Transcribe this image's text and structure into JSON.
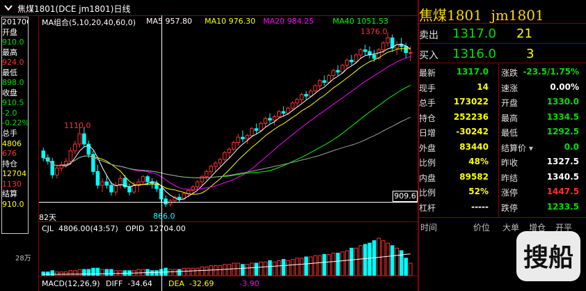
{
  "title": "焦煤1801(DCE jm1801)日线",
  "left_panel": [
    {
      "text": "20170601",
      "color": "#ffffff"
    },
    {
      "text": "开盘",
      "color": "#ffffff"
    },
    {
      "text": "910.0",
      "color": "#00e000"
    },
    {
      "text": "最高",
      "color": "#ffffff"
    },
    {
      "text": "924.0",
      "color": "#ff3030"
    },
    {
      "text": "最低",
      "color": "#ffffff"
    },
    {
      "text": "898.0",
      "color": "#00e000"
    },
    {
      "text": "收盘",
      "color": "#ffffff"
    },
    {
      "text": "910.5",
      "color": "#00e000"
    },
    {
      "text": "-2.0",
      "color": "#00e000"
    },
    {
      "text": "-0.22%",
      "color": "#00e000"
    },
    {
      "text": "总手",
      "color": "#ffffff"
    },
    {
      "text": "4806",
      "color": "#ffff00"
    },
    {
      "text": "676",
      "color": "#ff3030"
    },
    {
      "text": "持仓",
      "color": "#ffffff"
    },
    {
      "text": "12704",
      "color": "#ffff00"
    },
    {
      "text": "1130",
      "color": "#ff3030"
    },
    {
      "text": "结算",
      "color": "#ffffff"
    },
    {
      "text": "910.0",
      "color": "#ffff00"
    }
  ],
  "ma": {
    "label": "MA组合(5,10,20,40,60,0)",
    "items": [
      {
        "label": "MA5 957.80",
        "color": "#ffffff"
      },
      {
        "label": "MA10 976.30",
        "color": "#ffff00"
      },
      {
        "label": "MA20 984.25",
        "color": "#ff00ff"
      },
      {
        "label": "MA40 1051.53",
        "color": "#00ff00"
      }
    ]
  },
  "chart_labels": {
    "high": "1376.0",
    "mid_high": "1110.0",
    "low": "866.0",
    "price_tag": "909.6",
    "days": "82天"
  },
  "volume": {
    "header": "CJL  4806.00(43:57)   OPID  12704.00",
    "scale": "28万"
  },
  "macd": {
    "label": "MACD(12,26,9)",
    "diff": "DIFF  -34.64",
    "dea": "DEA  -32.69",
    "val": "-3.90"
  },
  "right": {
    "name": "焦煤1801",
    "code": "jm1801",
    "sell_label": "卖出",
    "sell_price": "1317.0",
    "sell_vol": "21",
    "buy_label": "买入",
    "buy_price": "1316.0",
    "buy_vol": "3",
    "rows": [
      {
        "l1": "最新",
        "v1": "1317.0",
        "c1": "green",
        "l2": "涨跌",
        "v2": "-23.5/1.75%",
        "c2": "green"
      },
      {
        "l1": "现手",
        "v1": "14",
        "c1": "yellow",
        "l2": "速涨",
        "v2": "0.00%",
        "c2": "white"
      },
      {
        "l1": "总手",
        "v1": "173022",
        "c1": "yellow",
        "l2": "开盘",
        "v2": "1330.0",
        "c2": "green"
      },
      {
        "l1": "持仓",
        "v1": "252236",
        "c1": "yellow",
        "l2": "最高",
        "v2": "1334.5",
        "c2": "green"
      },
      {
        "l1": "日增",
        "v1": "-30242",
        "c1": "yellow",
        "l2": "最低",
        "v2": "1292.5",
        "c2": "green"
      },
      {
        "l1": "外盘",
        "v1": "83440",
        "c1": "yellow",
        "l2": "结算价",
        "v2": "0.0",
        "c2": "green"
      },
      {
        "l1": "比例",
        "v1": "48%",
        "c1": "yellow",
        "l2": "昨收",
        "v2": "1327.5",
        "c2": "white"
      },
      {
        "l1": "内盘",
        "v1": "89582",
        "c1": "yellow",
        "l2": "昨结",
        "v2": "1340.5",
        "c2": "white"
      },
      {
        "l1": "比例",
        "v1": "52%",
        "c1": "yellow",
        "l2": "涨停",
        "v2": "1447.5",
        "c2": "red"
      },
      {
        "l1": "杠杆",
        "v1": "-----",
        "c1": "white",
        "l2": "跌停",
        "v2": "1233.5",
        "c2": "green"
      }
    ],
    "tick_header": [
      "时间",
      "价位",
      "大单",
      "增仓",
      "开平"
    ]
  },
  "chart_data": {
    "type": "candlestick",
    "title": "焦煤1801(DCE jm1801)日线",
    "ylim": [
      866,
      1376
    ],
    "bars": 82,
    "candles": [
      [
        1030,
        1040,
        1000,
        1010
      ],
      [
        1010,
        1020,
        990,
        1000
      ],
      [
        1000,
        1010,
        950,
        960
      ],
      [
        960,
        990,
        950,
        980
      ],
      [
        980,
        1000,
        970,
        990
      ],
      [
        990,
        1010,
        980,
        1000
      ],
      [
        1000,
        1040,
        990,
        1030
      ],
      [
        1030,
        1060,
        1020,
        1050
      ],
      [
        1050,
        1110,
        1040,
        1080
      ],
      [
        1080,
        1100,
        1040,
        1050
      ],
      [
        1050,
        1060,
        1010,
        1020
      ],
      [
        1020,
        1030,
        960,
        970
      ],
      [
        970,
        990,
        920,
        930
      ],
      [
        930,
        950,
        910,
        940
      ],
      [
        940,
        960,
        920,
        930
      ],
      [
        930,
        940,
        900,
        910
      ],
      [
        910,
        940,
        900,
        930
      ],
      [
        930,
        960,
        920,
        950
      ],
      [
        950,
        960,
        920,
        925
      ],
      [
        925,
        935,
        900,
        910
      ],
      [
        910,
        940,
        905,
        930
      ],
      [
        930,
        950,
        910,
        940
      ],
      [
        940,
        960,
        930,
        955
      ],
      [
        955,
        960,
        930,
        940
      ],
      [
        940,
        950,
        920,
        935
      ],
      [
        935,
        945,
        910,
        920
      ],
      [
        920,
        930,
        880,
        890
      ],
      [
        890,
        900,
        866,
        875
      ],
      [
        875,
        890,
        868,
        885
      ],
      [
        885,
        900,
        878,
        895
      ],
      [
        895,
        905,
        880,
        890
      ],
      [
        890,
        910,
        885,
        905
      ],
      [
        905,
        920,
        895,
        915
      ],
      [
        915,
        930,
        905,
        925
      ],
      [
        925,
        945,
        915,
        940
      ],
      [
        940,
        960,
        930,
        955
      ],
      [
        955,
        975,
        945,
        970
      ],
      [
        970,
        990,
        960,
        985
      ],
      [
        985,
        1000,
        970,
        995
      ],
      [
        995,
        1010,
        985,
        1005
      ],
      [
        1005,
        1030,
        1000,
        1025
      ],
      [
        1025,
        1040,
        1010,
        1035
      ],
      [
        1035,
        1060,
        1030,
        1055
      ],
      [
        1055,
        1080,
        1045,
        1070
      ],
      [
        1070,
        1090,
        1055,
        1065
      ],
      [
        1065,
        1080,
        1050,
        1075
      ],
      [
        1075,
        1100,
        1070,
        1095
      ],
      [
        1095,
        1110,
        1080,
        1090
      ],
      [
        1090,
        1115,
        1085,
        1110
      ],
      [
        1110,
        1130,
        1100,
        1125
      ],
      [
        1125,
        1140,
        1110,
        1120
      ],
      [
        1120,
        1135,
        1105,
        1130
      ],
      [
        1130,
        1150,
        1125,
        1145
      ],
      [
        1145,
        1160,
        1130,
        1140
      ],
      [
        1140,
        1160,
        1135,
        1155
      ],
      [
        1155,
        1175,
        1150,
        1170
      ],
      [
        1170,
        1185,
        1160,
        1180
      ],
      [
        1180,
        1200,
        1170,
        1195
      ],
      [
        1195,
        1205,
        1180,
        1190
      ],
      [
        1190,
        1210,
        1185,
        1205
      ],
      [
        1205,
        1225,
        1200,
        1220
      ],
      [
        1220,
        1240,
        1210,
        1235
      ],
      [
        1235,
        1250,
        1220,
        1230
      ],
      [
        1230,
        1255,
        1225,
        1250
      ],
      [
        1250,
        1270,
        1240,
        1265
      ],
      [
        1265,
        1280,
        1250,
        1260
      ],
      [
        1260,
        1285,
        1255,
        1280
      ],
      [
        1280,
        1300,
        1270,
        1295
      ],
      [
        1295,
        1310,
        1280,
        1290
      ],
      [
        1290,
        1315,
        1285,
        1310
      ],
      [
        1310,
        1330,
        1300,
        1325
      ],
      [
        1325,
        1340,
        1310,
        1320
      ],
      [
        1320,
        1335,
        1300,
        1310
      ],
      [
        1310,
        1325,
        1290,
        1300
      ],
      [
        1300,
        1330,
        1295,
        1325
      ],
      [
        1325,
        1350,
        1315,
        1345
      ],
      [
        1345,
        1376,
        1335,
        1360
      ],
      [
        1360,
        1370,
        1320,
        1330
      ],
      [
        1330,
        1350,
        1310,
        1340
      ],
      [
        1340,
        1360,
        1320,
        1335
      ],
      [
        1335,
        1345,
        1300,
        1317
      ],
      [
        1317,
        1335,
        1292,
        1317
      ]
    ],
    "volume": [
      3,
      3,
      4,
      3,
      3,
      3,
      4,
      4,
      5,
      5,
      5,
      6,
      6,
      5,
      5,
      5,
      4,
      4,
      4,
      4,
      4,
      5,
      5,
      5,
      4,
      4,
      5,
      6,
      5,
      5,
      5,
      6,
      6,
      6,
      6,
      7,
      7,
      8,
      8,
      8,
      9,
      9,
      10,
      10,
      9,
      9,
      10,
      10,
      11,
      11,
      12,
      11,
      12,
      13,
      12,
      13,
      14,
      14,
      15,
      15,
      16,
      16,
      17,
      17,
      18,
      18,
      19,
      20,
      22,
      22,
      24,
      25,
      26,
      28,
      30,
      28,
      26,
      24,
      22,
      20,
      14,
      10
    ]
  }
}
